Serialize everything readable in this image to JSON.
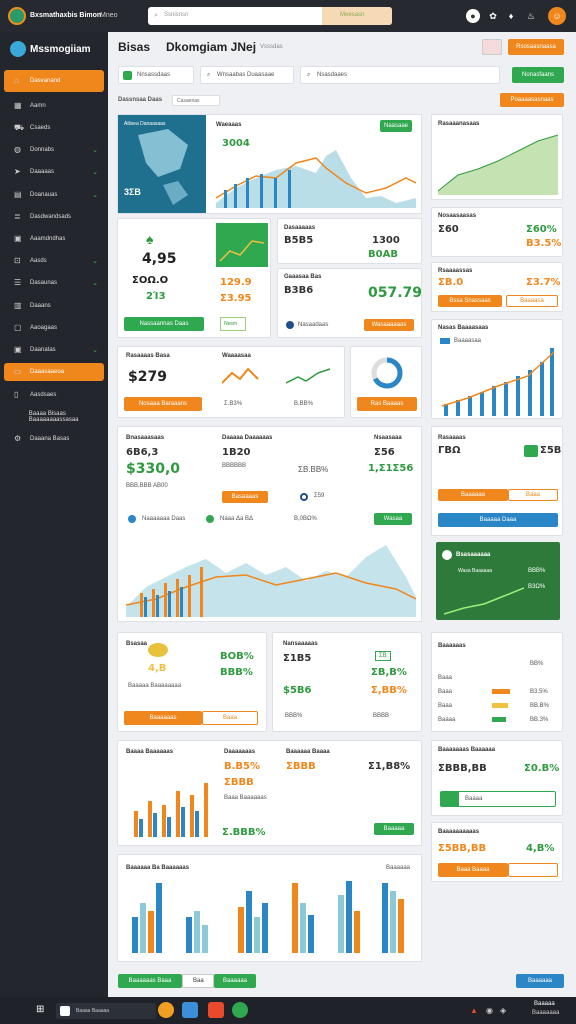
{
  "topbar": {
    "title": "Bxsmathaxbis Bimon",
    "subtitle": "Mneo",
    "search_placeholder": "Ssnisnsn",
    "search_button": "Meesasn"
  },
  "sidebar": {
    "brand": "Mssmogiiam",
    "items": [
      {
        "label": "Dasvanand",
        "icon": "home-icon",
        "active": true
      },
      {
        "label": "Aamn",
        "icon": "grid-icon"
      },
      {
        "label": "Csaeds",
        "icon": "truck-icon"
      },
      {
        "label": "Donnabs",
        "icon": "globe-icon",
        "chevron": true
      },
      {
        "label": "Daaaaas",
        "icon": "send-icon",
        "chevron": true
      },
      {
        "label": "Doanauas",
        "icon": "chart-icon",
        "chevron": true
      },
      {
        "label": "Dasdwandsads",
        "icon": "layers-icon"
      },
      {
        "label": "Aaamdndhas",
        "icon": "calendar-icon"
      },
      {
        "label": "Aasds",
        "icon": "lock-icon",
        "chevron": true
      },
      {
        "label": "Dasaunas",
        "icon": "list-icon",
        "chevron": true
      },
      {
        "label": "Daaans",
        "icon": "table-icon"
      },
      {
        "label": "Aaoagaas",
        "icon": "box-icon"
      },
      {
        "label": "Daanatas",
        "icon": "calendar2-icon",
        "chevron": true
      },
      {
        "label": "Daaasaaeoa",
        "icon": "note-icon",
        "active": true
      },
      {
        "label": "Aasdsaes",
        "icon": "doc-icon"
      },
      {
        "label": "Baaaa Bisaas Baaaaaaaassasaa",
        "icon": "none"
      },
      {
        "label": "Daaana Basas",
        "icon": "gear-icon"
      }
    ]
  },
  "header": {
    "title": "Bisas",
    "subtitle": "Dkomgiam JNej",
    "badge": "Vsssdas",
    "btn_primary": "Rsosaasnaasa",
    "btn_secondary": "Poesssa",
    "filter1": "Nnsassdaas",
    "filter2": "Wnsaabas Duaasaae",
    "filter3": "Nsasdaaes",
    "action": "Nonasfaans",
    "crumb": "Dassnsaa Daas",
    "crumb2": "Casaenas",
    "right_btn": "Poaaaasasnaas"
  },
  "cards": {
    "map_title": "Ailisea Danaasaas",
    "map_value": "3ΣΒ",
    "chart1_title": "Waeaaas",
    "chart1_stat": "3004",
    "chart1_btn": "Naasaae",
    "kpi1_big": "4,95",
    "kpi1_sub": "ΣΟΩ.Ο",
    "kpi1_pct": "2Ί3",
    "kpi1_btn": "Nassaannas Daas",
    "kpi1_btn2": "Nesm",
    "kpi2_val": "129.9",
    "kpi2_val2": "Σ3.95",
    "kpi3_title": "Dasaaaaas",
    "kpi3_val": "Β5Β5",
    "kpi3_val2": "1300",
    "kpi3_val3": "Β0ΑΒ",
    "kpi4_title": "Gaaasaa Bas",
    "kpi4_val": "Β3Β6",
    "kpi4_big": "057.79",
    "kpi4_btn": "Wasaaaaaas",
    "kpi4_lbl": "Nasaadaas",
    "side1_title": "Rasaaanasaas",
    "side2_title": "Nosaasaasas",
    "side2_val": "Σ60",
    "side2_pct": "Σ60%",
    "side2_pct2": "Β3.5%",
    "side3_title": "Rsaaaassas",
    "side3_val": "ΣΒ.0",
    "side3_pct": "Σ3.7%",
    "side3_btn": "Bssa Snassaas",
    "side3_btn2": "Baaaasa",
    "rev_title": "Rasaaaas Basa",
    "rev_val": "$279",
    "rev_btn": "Nosaaa Baraaans",
    "rev_pct": "Σ.Β3%",
    "mid_title": "Waaaasaa",
    "mid_pct": "Β,ΒΒ%",
    "donut_btn": "Ras Baaaas",
    "side4_title": "Nasas Baaaasaas",
    "side4_lbl": "Baaaasaa",
    "sales_title": "Bnasaaasaas",
    "sales_big": "6Β6,3",
    "sales_big2": "$330,0",
    "sales_sub": "ΒΒΒ,ΒΒΒ ΑΒ00",
    "sales_col2": "Daaaaa Daaaaaas",
    "sales_col2_val": "1Β20",
    "sales_col2_pct": "ΒΒΒΒΒΒ",
    "sales_col3": "Nsaasaaa",
    "sales_col3_val": "Σ56",
    "sales_col3_sub": "1,Σ1Σ56",
    "sales_orange": "ΣΒ.ΒΒ%",
    "sales_btn": "Basaaaas",
    "sales_pill1": "Naaaaaaa Daas",
    "sales_pill2": "Naaa Δa ΒΔ",
    "sales_pct": "Β,0ΒΩ%",
    "sales_btn2": "Wasaa",
    "sales_val3": "Σ59",
    "side5_title": "Rasaaaas",
    "side5_val": "ΓΒΩ",
    "side5_pct": "Σ5Β",
    "side5_btn": "Baaaaaa",
    "side5_btn2": "Baaa",
    "side5_bar": "Baaaaa Daaa",
    "side5_bar2": "Baaaa",
    "green_title": "Bsasaaaaaa",
    "green_lbl": "Wasa Baaaaaa",
    "green_pct": "ΒΒΒ%",
    "green_pct2": "Β3Ω%",
    "row3a_title": "Bsasaa",
    "row3a_val": "4,Β",
    "row3a_lbl": "Baaaaa Baaaaaaaa",
    "row3a_btn": "Baaaaaas",
    "row3a_btn2": "Baaa",
    "row3a_pct": "ΒΟΒ%",
    "row3a_pct2": "ΒΒΒ%",
    "row3b_title": "Nansaaaaas",
    "row3b_val": "Σ1Β5",
    "row3b_val2": "$5Β6",
    "row3b_badge": "ΣΒ",
    "row3b_pct": "ΣΒ,Β%",
    "row3b_pct2": "Σ,ΒΒ%",
    "row3b_pct3": "ΒΒΒ%",
    "row3b_pct4": "ΒΒΒΒ",
    "side6_title": "Baaaaaas",
    "side6_rows": [
      "Baaa",
      "Baaa",
      "Baaa",
      "Baaaa"
    ],
    "side6_pcts": [
      "ΒΒ%",
      "Β3.5%",
      "ΒΒ.Β%",
      "ΒΒ.3%"
    ],
    "bar1_title": "Baaaa Baaaaaas",
    "bar1_pct": "Β.Β5%",
    "bar1_btn": "Baaaaa",
    "bar2_title": "Daaaaaaas",
    "bar2_val": "ΣΒΒΒ",
    "bar2_pct": "Σ.ΒΒΒ%",
    "bar2_lbl": "Baaa Baaaaaas",
    "bar3_title": "Baaaaaa Baaaa",
    "bar3_val": "ΣΒΒΒ",
    "bar3_pct": "Σ1,Β8%",
    "side7_title": "Baaaaaaas Baaaaaa",
    "side7_val": "ΣΒΒΒ,ΒΒ",
    "side7_pct": "Σ0.Β%",
    "side7_btn": "Baaaa",
    "side8_title": "Baaaaaaaaaas",
    "side8_val": "Σ5ΒΒ,ΒΒ",
    "side8_pct": "4,Β%",
    "side8_btn": "Baaa Baaaa",
    "bottom_title": "Baaaaaa Ba Baaaaaas",
    "bottom_lbl": "Baaaaaa",
    "footer_btn1": "Baaaaaas Baaa",
    "footer_btn2": "Baaaaaa",
    "footer_lbl": "Baa",
    "footer_right": "Baaaaaa"
  },
  "taskbar": {
    "search": "Baaaa Baaaaa",
    "time": "Baaaaa",
    "date": "Baaaaaaa"
  },
  "colors": {
    "accent": "#f0871c",
    "green": "#2fa84f",
    "blue": "#2a86c4",
    "teal": "#3a8fa8"
  }
}
